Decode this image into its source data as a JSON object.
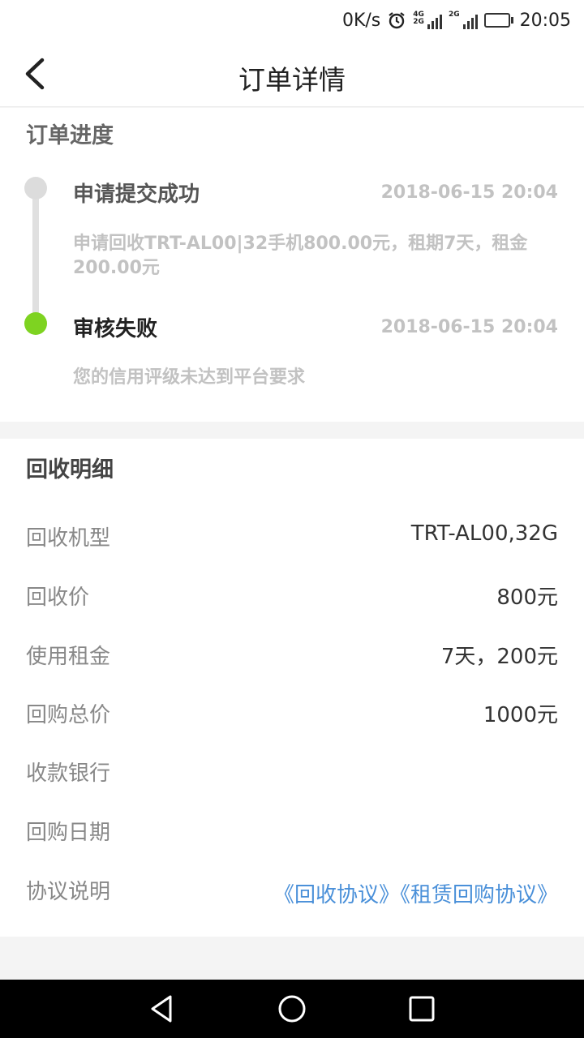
{
  "status_bar": {
    "speed": "0K/s",
    "sim1_tag": "4G\n2G",
    "sim2_tag": "2G",
    "time": "20:05",
    "battery_level": 0.45
  },
  "header": {
    "title": "订单详情",
    "back_icon": "chevron-left-icon"
  },
  "progress": {
    "title": "订单进度",
    "steps": [
      {
        "title": "申请提交成功",
        "time": "2018-06-15 20:04",
        "desc": "申请回收TRT-AL00|32手机800.00元，租期7天，租金200.00元",
        "status_color": "#dcdcdc"
      },
      {
        "title": "审核失败",
        "time": "2018-06-15 20:04",
        "desc": "您的信用评级未达到平台要求",
        "status_color": "#7ed321"
      }
    ]
  },
  "details": {
    "title": "回收明细",
    "rows": [
      {
        "label": "回收机型",
        "value": "TRT-AL00,32G"
      },
      {
        "label": "回收价",
        "value": "800元"
      },
      {
        "label": "使用租金",
        "value": "7天，200元"
      },
      {
        "label": "回购总价",
        "value": "1000元"
      },
      {
        "label": "收款银行",
        "value": ""
      },
      {
        "label": "回购日期",
        "value": ""
      },
      {
        "label": "协议说明",
        "links": [
          "《回收协议》",
          "《租赁回购协议》"
        ]
      }
    ]
  },
  "colors": {
    "accent_link": "#4a90d9",
    "success_green": "#7ed321",
    "muted_gray": "#c2c2c2"
  },
  "nav_bar": {
    "back": "triangle-back-icon",
    "home": "circle-home-icon",
    "recents": "square-recents-icon"
  }
}
